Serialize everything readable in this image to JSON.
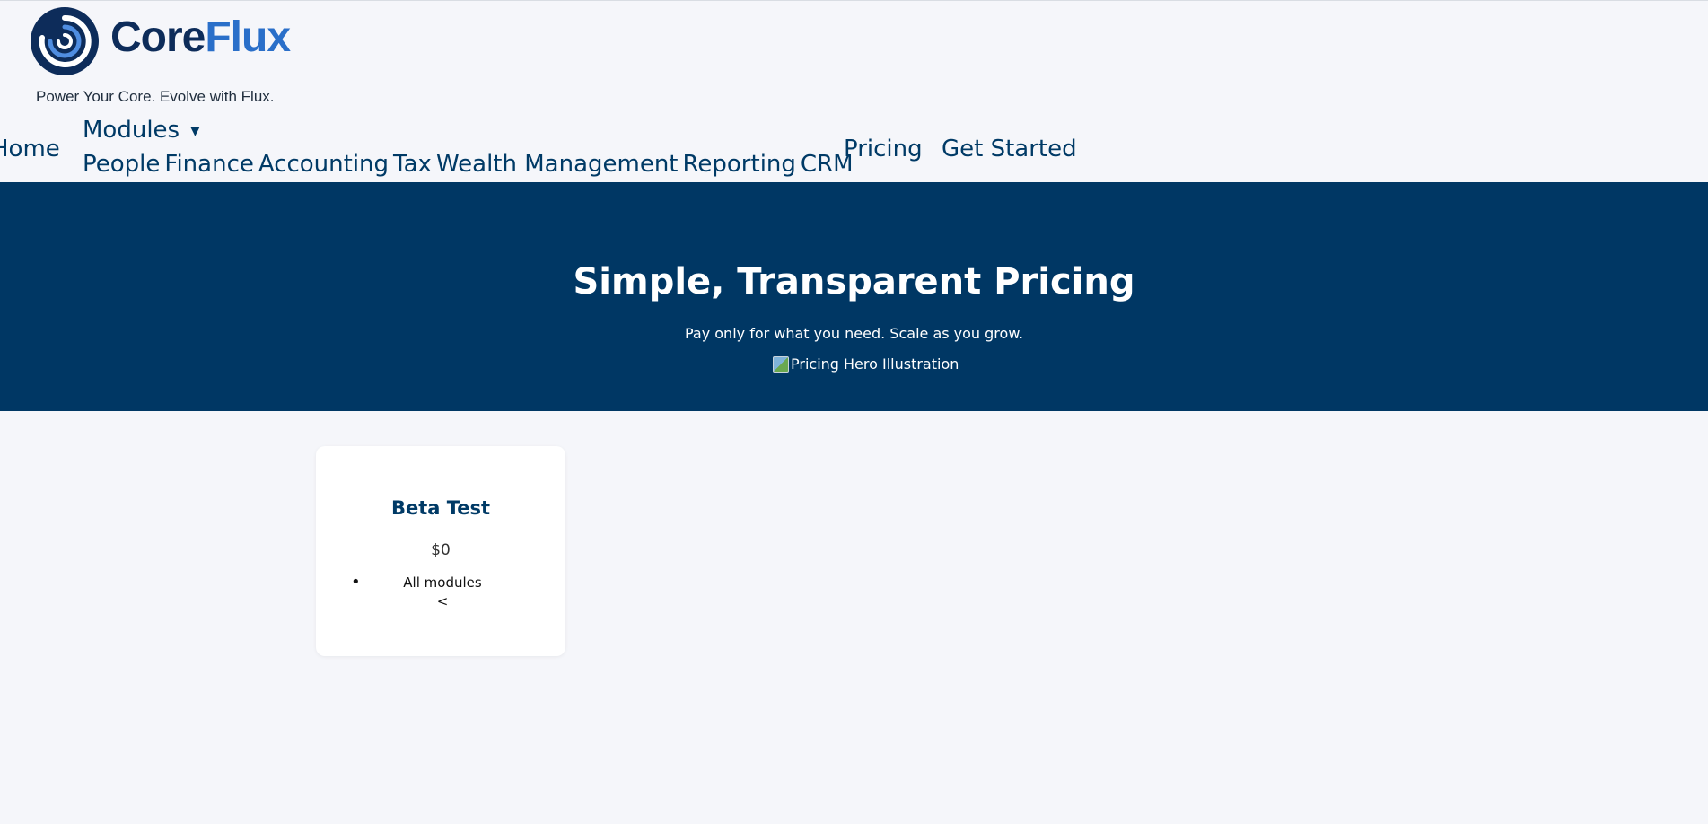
{
  "brand": {
    "name_core": "Core",
    "name_flux": "Flux",
    "tagline": "Power Your Core. Evolve with Flux.",
    "colors": {
      "core": "#0d2c5a",
      "flux": "#2a6fc9",
      "hero_bg": "#003764",
      "text": "#003a66",
      "page_bg": "#f5f6fa"
    }
  },
  "nav": {
    "home": "Home",
    "modules": "Modules",
    "modules_caret_icon": "caret-down-icon",
    "modules_items": [
      "People",
      "Finance",
      "Accounting",
      "Tax",
      "Wealth Management",
      "Reporting",
      "CRM"
    ],
    "pricing": "Pricing",
    "get_started": "Get Started"
  },
  "hero": {
    "title": "Simple, Transparent Pricing",
    "subtitle": "Pay only for what you need. Scale as you grow.",
    "image_alt": "Pricing Hero Illustration",
    "image_icon": "broken-image-icon"
  },
  "plans": [
    {
      "name": "Beta Test",
      "price": "$0",
      "features": [
        "All modules"
      ],
      "stray_text": "<"
    }
  ]
}
